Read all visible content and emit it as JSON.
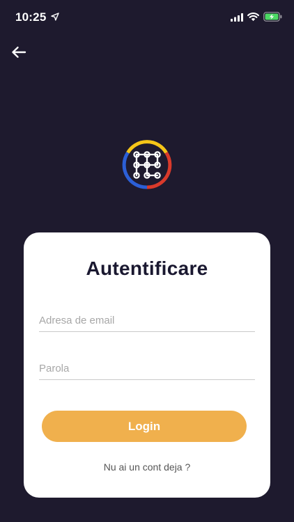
{
  "status_bar": {
    "time": "10:25",
    "icons": [
      "location-arrow-icon",
      "cellular-signal-icon",
      "wifi-icon",
      "battery-charging-icon"
    ],
    "battery_color": "#4cd964"
  },
  "nav": {
    "back_icon": "arrow-left-icon"
  },
  "logo": {
    "ring_colors": [
      "#f5c518",
      "#d93a2b",
      "#2c5fd6"
    ]
  },
  "card": {
    "title": "Autentificare",
    "email_placeholder": "Adresa de email",
    "password_placeholder": "Parola",
    "login_label": "Login",
    "register_link": "Nu ai un cont deja ?"
  },
  "colors": {
    "background": "#1e1a2e",
    "card": "#ffffff",
    "accent": "#f0b04d"
  }
}
